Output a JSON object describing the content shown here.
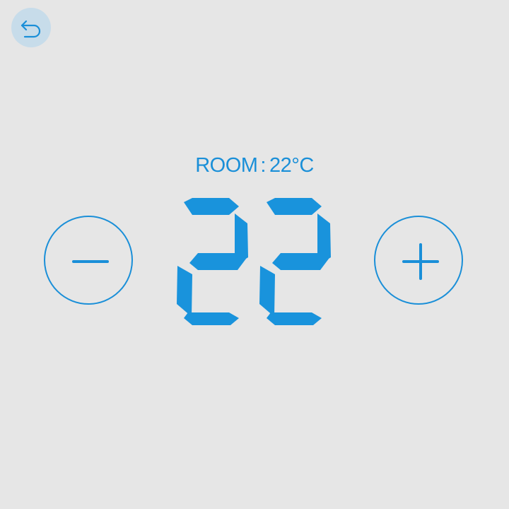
{
  "screen": {
    "title": "",
    "background_color": "#e6e6e6",
    "accent_color": "#1a8fd8"
  },
  "back_button": {
    "icon": "undo-arrow-icon",
    "background_color": "#c7dcea"
  },
  "room": {
    "label": "ROOM",
    "separator": ":",
    "temperature": "22",
    "unit": "°C"
  },
  "setpoint": {
    "value": "22",
    "digit_color": "#1993dc"
  },
  "controls": {
    "decrease_icon": "minus-icon",
    "increase_icon": "plus-icon"
  }
}
